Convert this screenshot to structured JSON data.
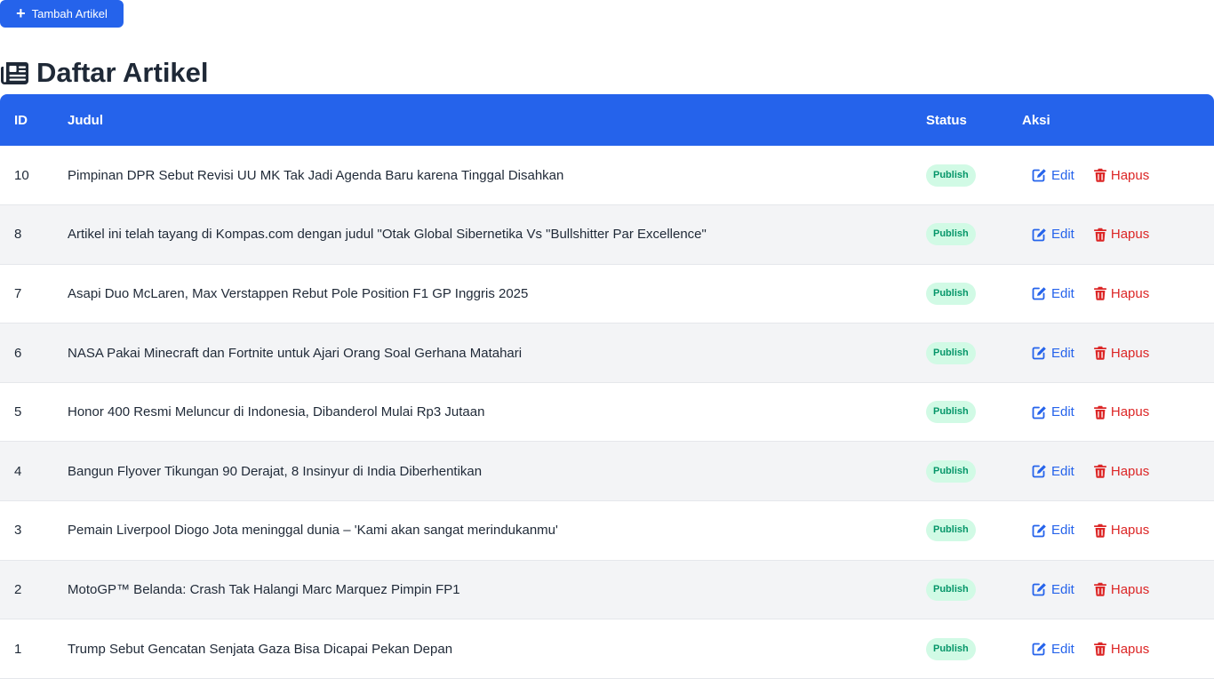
{
  "toolbar": {
    "add_label": "Tambah Artikel",
    "add_icon": "plus-icon"
  },
  "page": {
    "title": "Daftar Artikel",
    "title_icon": "newspaper-icon"
  },
  "colors": {
    "primary": "#2563eb",
    "danger": "#dc2626",
    "badge_bg": "#d1fae5",
    "badge_text": "#059669"
  },
  "table": {
    "headers": {
      "id": "ID",
      "title": "Judul",
      "status": "Status",
      "actions": "Aksi"
    },
    "action_labels": {
      "edit": "Edit",
      "delete": "Hapus"
    },
    "action_icons": {
      "edit": "edit-icon",
      "delete": "trash-icon"
    },
    "rows": [
      {
        "id": "10",
        "title": "Pimpinan DPR Sebut Revisi UU MK Tak Jadi Agenda Baru karena Tinggal Disahkan",
        "status": "Publish"
      },
      {
        "id": "8",
        "title": "Artikel ini telah tayang di Kompas.com dengan judul \"Otak Global Sibernetika Vs \"Bullshitter Par Excellence\"",
        "status": "Publish"
      },
      {
        "id": "7",
        "title": "Asapi Duo McLaren, Max Verstappen Rebut Pole Position F1 GP Inggris 2025",
        "status": "Publish"
      },
      {
        "id": "6",
        "title": "NASA Pakai Minecraft dan Fortnite untuk Ajari Orang Soal Gerhana Matahari",
        "status": "Publish"
      },
      {
        "id": "5",
        "title": "Honor 400 Resmi Meluncur di Indonesia, Dibanderol Mulai Rp3 Jutaan",
        "status": "Publish"
      },
      {
        "id": "4",
        "title": "Bangun Flyover Tikungan 90 Derajat, 8 Insinyur di India Diberhentikan",
        "status": "Publish"
      },
      {
        "id": "3",
        "title": "Pemain Liverpool Diogo Jota meninggal dunia – 'Kami akan sangat merindukanmu'",
        "status": "Publish"
      },
      {
        "id": "2",
        "title": "MotoGP™ Belanda: Crash Tak Halangi Marc Marquez Pimpin FP1",
        "status": "Publish"
      },
      {
        "id": "1",
        "title": "Trump Sebut Gencatan Senjata Gaza Bisa Dicapai Pekan Depan",
        "status": "Publish"
      }
    ]
  }
}
